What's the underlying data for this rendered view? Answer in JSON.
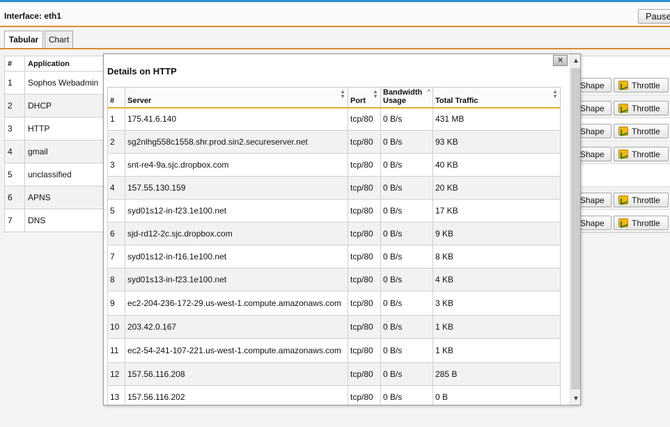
{
  "header": {
    "interface_title": "Interface: eth1",
    "pause_label": "Pause"
  },
  "tabs": [
    {
      "label": "Tabular",
      "active": true
    },
    {
      "label": "Chart",
      "active": false
    }
  ],
  "background_table": {
    "headers": {
      "num": "#",
      "application": "Application"
    },
    "rows": [
      {
        "num": "1",
        "application": "Sophos Webadmin",
        "actions": true
      },
      {
        "num": "2",
        "application": "DHCP",
        "actions": true
      },
      {
        "num": "3",
        "application": "HTTP",
        "actions": true
      },
      {
        "num": "4",
        "application": "gmail",
        "actions": true
      },
      {
        "num": "5",
        "application": "unclassified",
        "actions": false
      },
      {
        "num": "6",
        "application": "APNS",
        "actions": true
      },
      {
        "num": "7",
        "application": "DNS",
        "actions": true
      }
    ],
    "shape_label": "Shape",
    "throttle_label": "Throttle"
  },
  "dialog": {
    "title": "Details on HTTP",
    "close_glyph": "✕",
    "columns": {
      "num": "#",
      "server": "Server",
      "port": "Port",
      "bandwidth": "Bandwidth Usage",
      "total": "Total Traffic"
    },
    "rows": [
      {
        "num": "1",
        "server": "175.41.6.140",
        "port": "tcp/80",
        "bandwidth": "0 B/s",
        "total": "431 MB"
      },
      {
        "num": "2",
        "server": "sg2nlhg558c1558.shr.prod.sin2.secureserver.net",
        "port": "tcp/80",
        "bandwidth": "0 B/s",
        "total": "93 KB"
      },
      {
        "num": "3",
        "server": "snt-re4-9a.sjc.dropbox.com",
        "port": "tcp/80",
        "bandwidth": "0 B/s",
        "total": "40 KB"
      },
      {
        "num": "4",
        "server": "157.55.130.159",
        "port": "tcp/80",
        "bandwidth": "0 B/s",
        "total": "20 KB"
      },
      {
        "num": "5",
        "server": "syd01s12-in-f23.1e100.net",
        "port": "tcp/80",
        "bandwidth": "0 B/s",
        "total": "17 KB"
      },
      {
        "num": "6",
        "server": "sjd-rd12-2c.sjc.dropbox.com",
        "port": "tcp/80",
        "bandwidth": "0 B/s",
        "total": "9 KB"
      },
      {
        "num": "7",
        "server": "syd01s12-in-f16.1e100.net",
        "port": "tcp/80",
        "bandwidth": "0 B/s",
        "total": "8 KB"
      },
      {
        "num": "8",
        "server": "syd01s13-in-f23.1e100.net",
        "port": "tcp/80",
        "bandwidth": "0 B/s",
        "total": "4 KB"
      },
      {
        "num": "9",
        "server": "ec2-204-236-172-29.us-west-1.compute.amazonaws.com",
        "port": "tcp/80",
        "bandwidth": "0 B/s",
        "total": "3 KB"
      },
      {
        "num": "10",
        "server": "203.42.0.167",
        "port": "tcp/80",
        "bandwidth": "0 B/s",
        "total": "1 KB"
      },
      {
        "num": "11",
        "server": "ec2-54-241-107-221.us-west-1.compute.amazonaws.com",
        "port": "tcp/80",
        "bandwidth": "0 B/s",
        "total": "1 KB"
      },
      {
        "num": "12",
        "server": "157.56.116.208",
        "port": "tcp/80",
        "bandwidth": "0 B/s",
        "total": "285 B"
      },
      {
        "num": "13",
        "server": "157.56.116.202",
        "port": "tcp/80",
        "bandwidth": "0 B/s",
        "total": "0 B"
      }
    ]
  },
  "colors": {
    "accent_orange": "#e08a28",
    "top_strip_blue": "#2e8fd1",
    "header_underline_gold": "#e0b030"
  }
}
